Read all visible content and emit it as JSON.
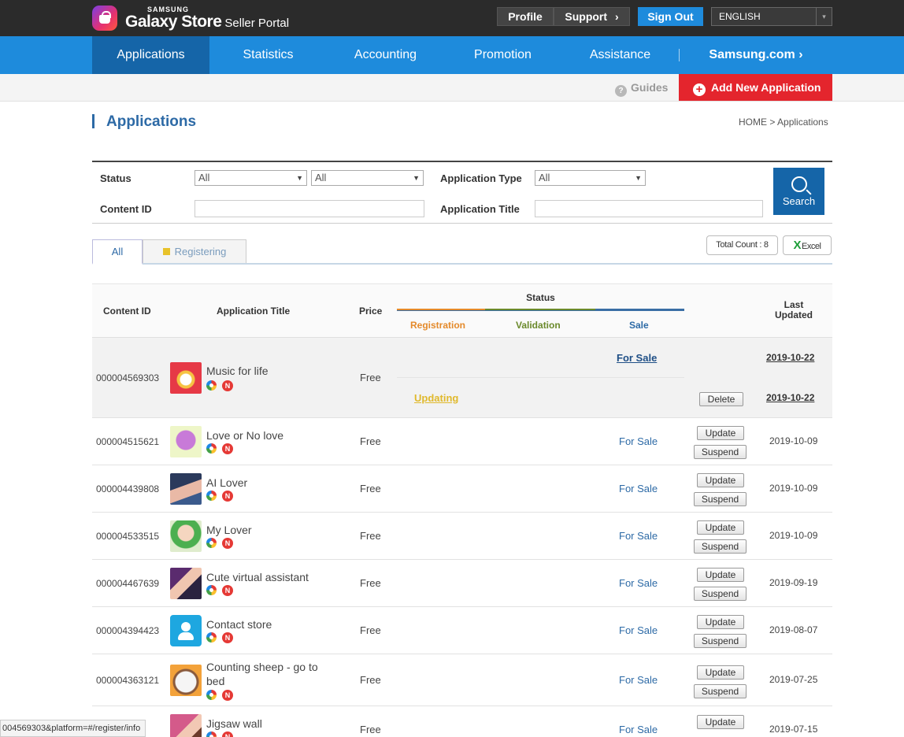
{
  "header": {
    "brand_top": "SAMSUNG",
    "brand_main": "Galaxy Store",
    "brand_sub": "Seller Portal",
    "profile": "Profile",
    "support": "Support",
    "sign_out": "Sign Out",
    "language": "ENGLISH"
  },
  "nav": {
    "items": [
      "Applications",
      "Statistics",
      "Accounting",
      "Promotion",
      "Assistance",
      "Samsung.com"
    ]
  },
  "subbar": {
    "guides": "Guides",
    "add_new": "Add New Application"
  },
  "page": {
    "title": "Applications",
    "breadcrumb": "HOME  >  Applications"
  },
  "search": {
    "status_label": "Status",
    "status_value_1": "All",
    "status_value_2": "All",
    "app_type_label": "Application Type",
    "app_type_value": "All",
    "content_id_label": "Content ID",
    "app_title_label": "Application Title",
    "button": "Search"
  },
  "tabs": {
    "all": "All",
    "registering": "Registering"
  },
  "tools": {
    "total_count": "Total Count : 8",
    "excel": "Excel"
  },
  "table": {
    "headers": {
      "content_id": "Content ID",
      "app_title": "Application Title",
      "price": "Price",
      "status": "Status",
      "registration": "Registration",
      "validation": "Validation",
      "sale": "Sale",
      "last_updated": "Last\nUpdated"
    },
    "first_row": {
      "content_id": "000004569303",
      "title": "Music for life",
      "price": "Free",
      "sale": "For Sale",
      "date_1": "2019-10-22",
      "registration": "Updating",
      "delete": "Delete",
      "date_2": "2019-10-22"
    },
    "rows": [
      {
        "content_id": "000004515621",
        "title": "Love or No love",
        "price": "Free",
        "sale": "For Sale",
        "date": "2019-10-09"
      },
      {
        "content_id": "000004439808",
        "title": "AI Lover",
        "price": "Free",
        "sale": "For Sale",
        "date": "2019-10-09"
      },
      {
        "content_id": "000004533515",
        "title": "My Lover",
        "price": "Free",
        "sale": "For Sale",
        "date": "2019-10-09"
      },
      {
        "content_id": "000004467639",
        "title": "Cute virtual assistant",
        "price": "Free",
        "sale": "For Sale",
        "date": "2019-09-19"
      },
      {
        "content_id": "000004394423",
        "title": "Contact store",
        "price": "Free",
        "sale": "For Sale",
        "date": "2019-08-07"
      },
      {
        "content_id": "000004363121",
        "title": "Counting sheep - go to bed",
        "price": "Free",
        "sale": "For Sale",
        "date": "2019-07-25"
      },
      {
        "content_id": "",
        "title": "Jigsaw wall",
        "price": "Free",
        "sale": "For Sale",
        "date": "2019-07-15"
      }
    ],
    "update_label": "Update",
    "suspend_label": "Suspend",
    "badge_n": "N"
  },
  "statusbar": {
    "url": "004569303&platform=#/register/info"
  },
  "colors": {
    "nav_blue": "#1e8bdc",
    "active_nav": "#1565a8",
    "add_red": "#e4252d"
  }
}
